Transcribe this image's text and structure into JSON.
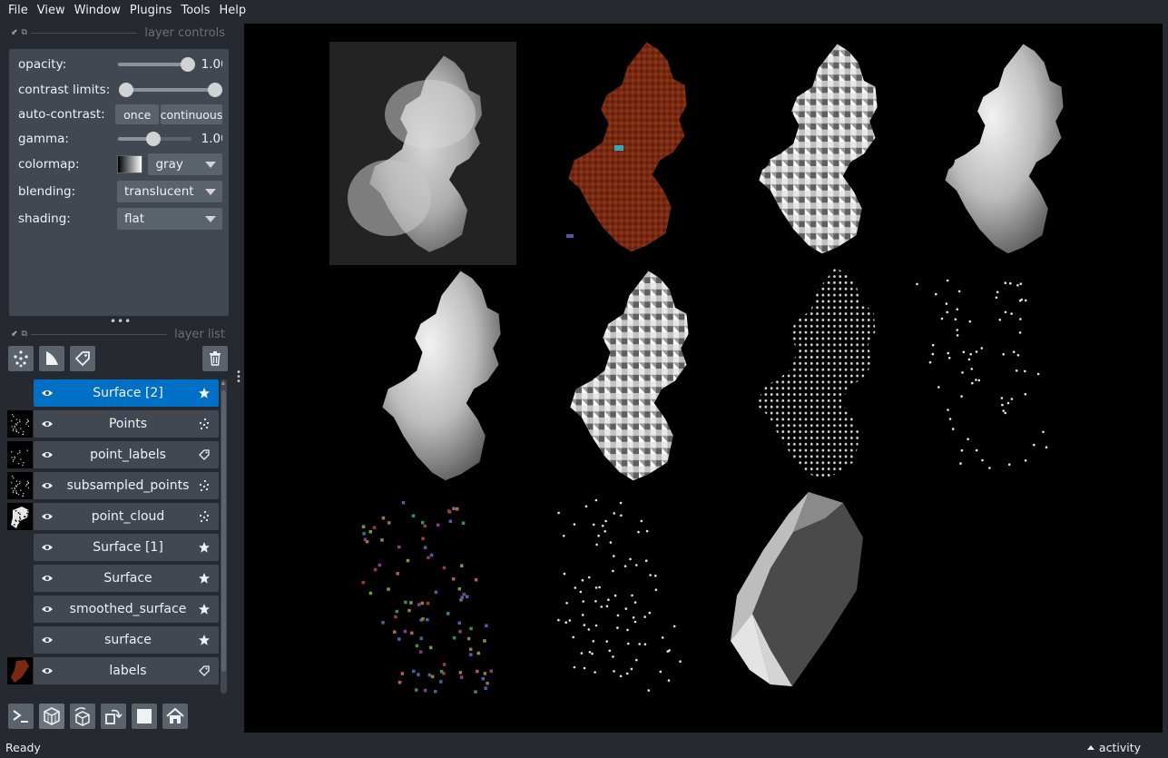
{
  "menubar": {
    "items": [
      "File",
      "View",
      "Window",
      "Plugins",
      "Tools",
      "Help"
    ]
  },
  "layer_controls": {
    "title": "layer controls",
    "opacity": {
      "label": "opacity:",
      "value": "1.00",
      "level": 1.0
    },
    "contrast_limits": {
      "label": "contrast limits:",
      "low": 0.0,
      "high": 1.0
    },
    "auto_contrast": {
      "label": "auto-contrast:",
      "once": "once",
      "continuous": "continuous"
    },
    "gamma": {
      "label": "gamma:",
      "value": "1.00",
      "level": 0.45
    },
    "colormap": {
      "label": "colormap:",
      "value": "gray"
    },
    "blending": {
      "label": "blending:",
      "value": "translucent"
    },
    "shading": {
      "label": "shading:",
      "value": "flat"
    }
  },
  "layer_list": {
    "title": "layer list",
    "layers": [
      {
        "name": "Surface [2]",
        "type": "surface",
        "selected": true,
        "thumb": "none"
      },
      {
        "name": "Points",
        "type": "points",
        "selected": false,
        "thumb": "points"
      },
      {
        "name": "point_labels",
        "type": "labels-tag",
        "selected": false,
        "thumb": "sparse"
      },
      {
        "name": "subsampled_points",
        "type": "points",
        "selected": false,
        "thumb": "points"
      },
      {
        "name": "point_cloud",
        "type": "points",
        "selected": false,
        "thumb": "cloud"
      },
      {
        "name": "Surface [1]",
        "type": "surface",
        "selected": false,
        "thumb": "none"
      },
      {
        "name": "Surface",
        "type": "surface",
        "selected": false,
        "thumb": "none"
      },
      {
        "name": "smoothed_surface",
        "type": "surface",
        "selected": false,
        "thumb": "none"
      },
      {
        "name": "surface",
        "type": "surface",
        "selected": false,
        "thumb": "none"
      },
      {
        "name": "labels",
        "type": "labels-tag",
        "selected": false,
        "thumb": "labels"
      }
    ]
  },
  "status": {
    "text": "Ready",
    "activity": "activity"
  },
  "colors": {
    "accent": "#0070c6",
    "panel": "#414851",
    "background": "#262930",
    "labels_red": "#7a2a12"
  }
}
